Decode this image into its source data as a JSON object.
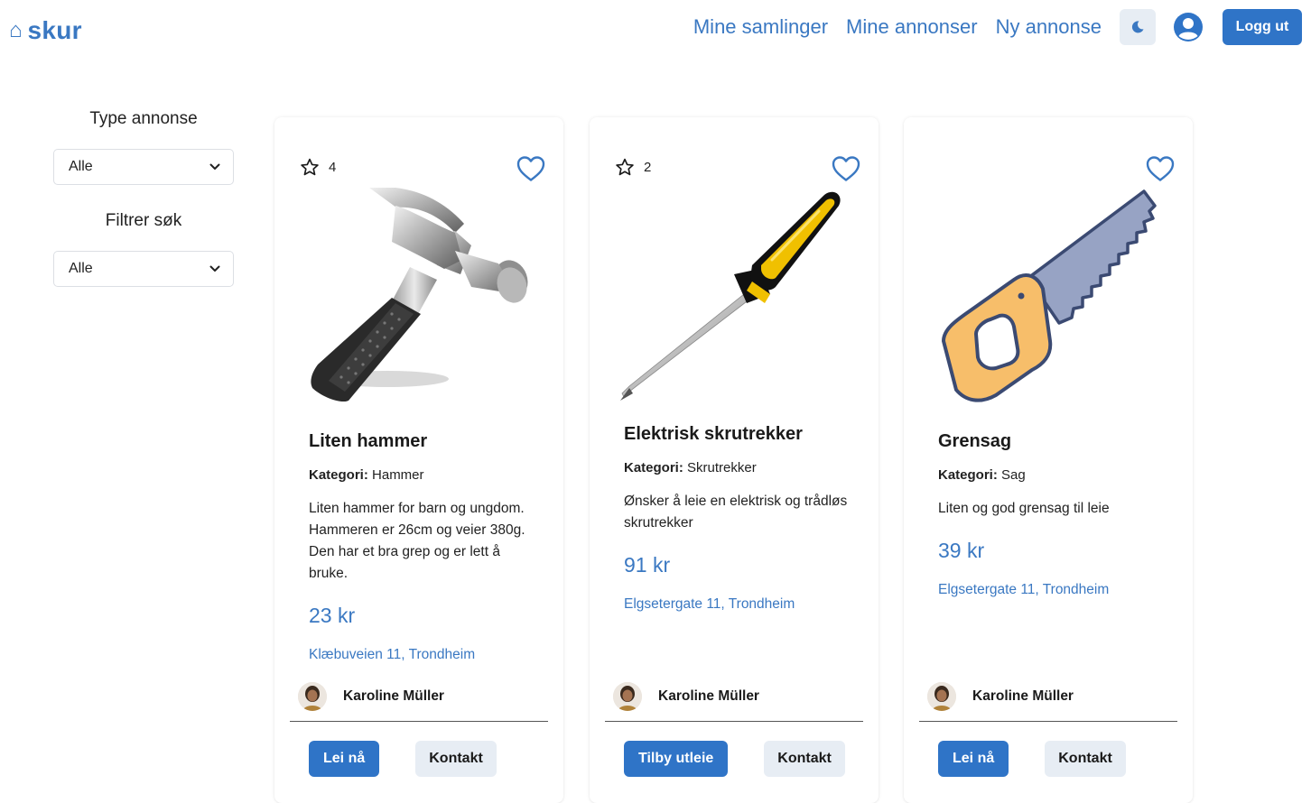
{
  "header": {
    "logo_icon": "⌂",
    "logo_text": "skur",
    "nav": {
      "collections": "Mine samlinger",
      "my_ads": "Mine annonser",
      "new_ad": "Ny annonse"
    },
    "logout_label": "Logg ut",
    "accent_color": "#3a78c2"
  },
  "sidebar": {
    "type_label": "Type annonse",
    "type_value": "Alle",
    "filter_label": "Filtrer søk",
    "filter_value": "Alle"
  },
  "cards": [
    {
      "rating": "4",
      "title": "Liten hammer",
      "category_label": "Kategori:",
      "category": "Hammer",
      "description": "Liten hammer for barn og ungdom. Hammeren er 26cm og veier 380g. Den har et bra grep og er lett å bruke.",
      "price": "23 kr",
      "address": "Klæbuveien 11, Trondheim",
      "owner": "Karoline Müller",
      "primary_action": "Lei nå",
      "secondary_action": "Kontakt",
      "image_icon": "hammer-icon"
    },
    {
      "rating": "2",
      "title": "Elektrisk skrutrekker",
      "category_label": "Kategori:",
      "category": "Skrutrekker",
      "description": "Ønsker å leie en elektrisk og trådløs skrutrekker",
      "price": "91 kr",
      "address": "Elgsetergate 11, Trondheim",
      "owner": "Karoline Müller",
      "primary_action": "Tilby utleie",
      "secondary_action": "Kontakt",
      "image_icon": "screwdriver-icon"
    },
    {
      "title": "Grensag",
      "category_label": "Kategori:",
      "category": "Sag",
      "description": "Liten og god grensag til leie",
      "price": "39 kr",
      "address": "Elgsetergate 11, Trondheim",
      "owner": "Karoline Müller",
      "primary_action": "Lei nå",
      "secondary_action": "Kontakt",
      "image_icon": "saw-icon"
    }
  ]
}
